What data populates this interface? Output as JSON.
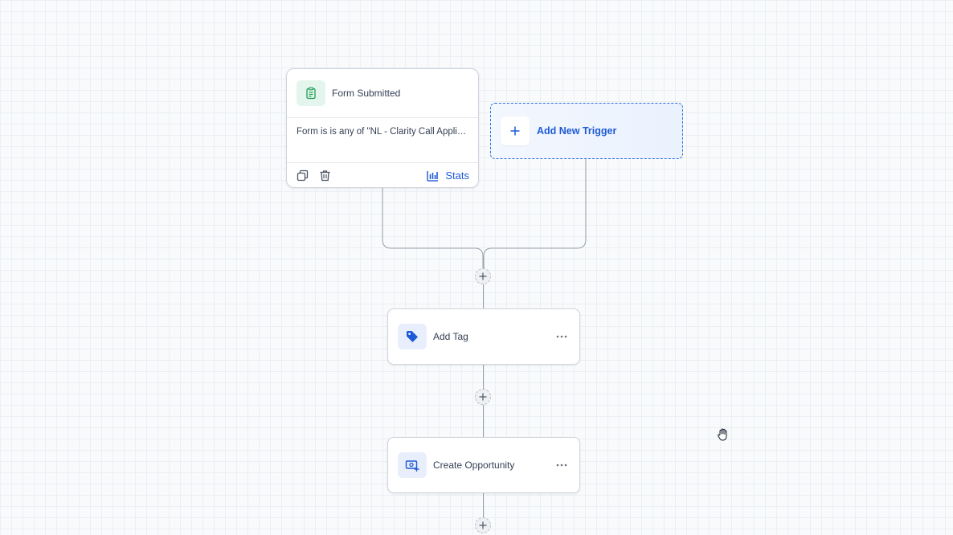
{
  "colors": {
    "accent": "#1e5ad6",
    "trigger_icon_green": "#1f9d55",
    "canvas_bg": "#f8fafc",
    "connector": "#9aa1ab"
  },
  "trigger": {
    "icon": "clipboard-icon",
    "title": "Form Submitted",
    "condition": "Form is is any of \"NL - Clarity Call Application\"",
    "copy_icon": "copy-icon",
    "delete_icon": "trash-icon",
    "stats_icon": "bar-chart-icon",
    "stats_label": "Stats"
  },
  "add_trigger": {
    "icon": "plus-icon",
    "label": "Add New Trigger"
  },
  "actions": [
    {
      "icon": "tag-icon",
      "label": "Add Tag",
      "menu_icon": "more-horizontal-icon"
    },
    {
      "icon": "opportunity-icon",
      "label": "Create Opportunity",
      "menu_icon": "more-horizontal-icon"
    }
  ],
  "add_step_nodes": [
    {
      "icon": "plus-icon"
    },
    {
      "icon": "plus-icon"
    },
    {
      "icon": "plus-icon"
    }
  ],
  "cursor": {
    "icon": "hand-grab-icon"
  }
}
